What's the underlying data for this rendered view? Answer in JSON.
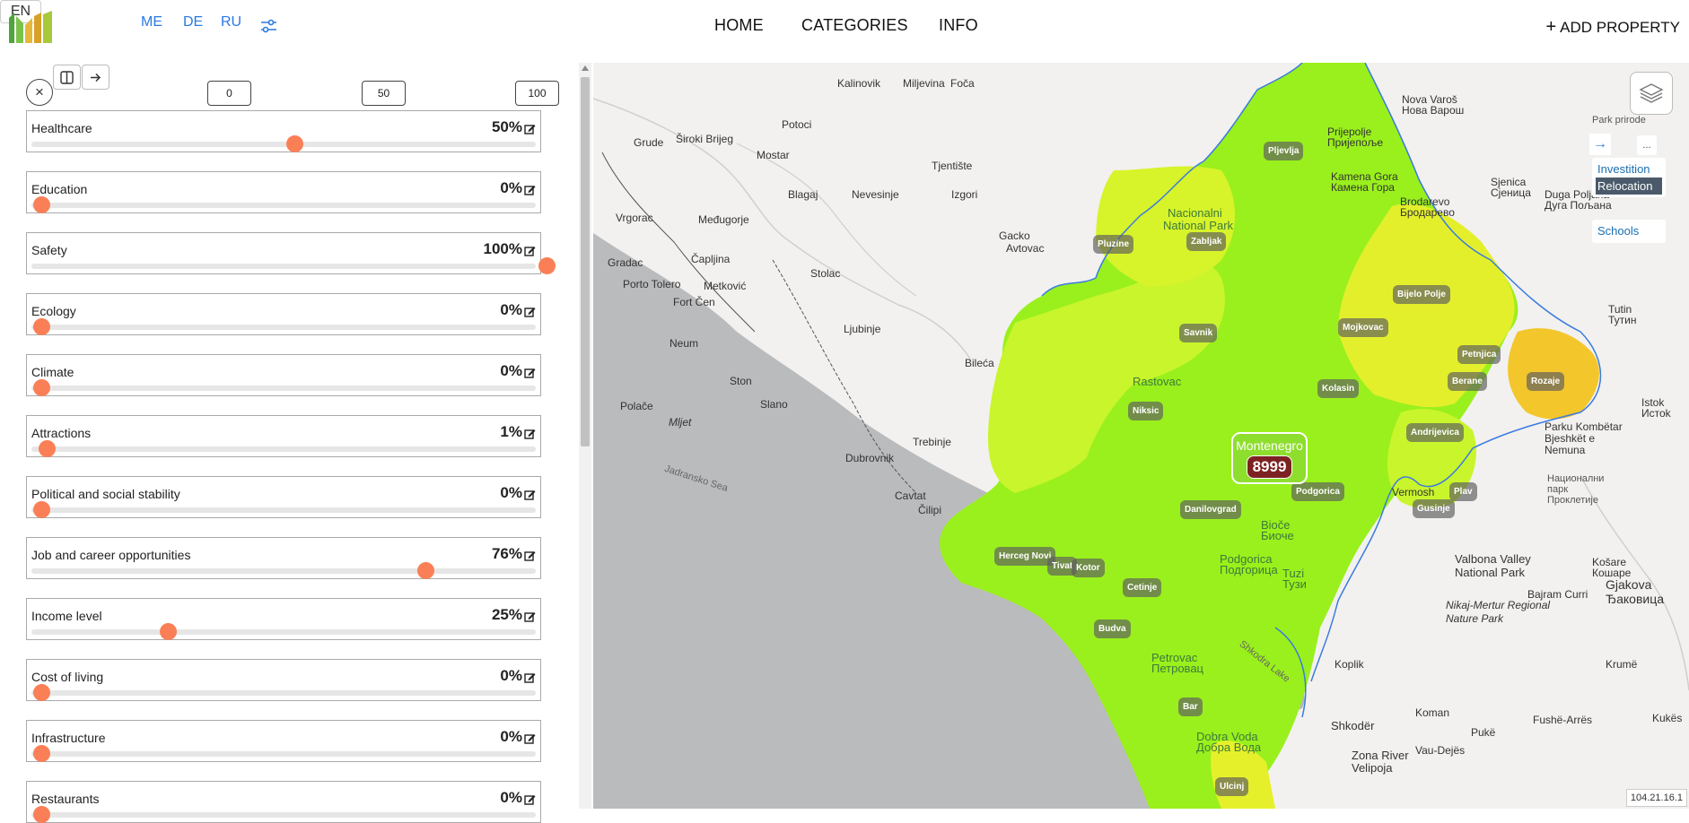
{
  "header": {
    "languages": [
      "EN",
      "ME",
      "DE",
      "RU"
    ],
    "active_language": "EN",
    "nav": [
      "HOME",
      "CATEGORIES",
      "INFO"
    ],
    "add_property": "ADD PROPERTY"
  },
  "sidebar": {
    "scale_marks": [
      "0",
      "50",
      "100"
    ],
    "criteria": [
      {
        "label": "Healthcare",
        "value": "50%",
        "level": 50
      },
      {
        "label": "Education",
        "value": "0%",
        "level": 0
      },
      {
        "label": "Safety",
        "value": "100%",
        "level": 100
      },
      {
        "label": "Ecology",
        "value": "0%",
        "level": 0
      },
      {
        "label": "Climate",
        "value": "0%",
        "level": 0
      },
      {
        "label": "Attractions",
        "value": "1%",
        "level": 1
      },
      {
        "label": "Political and social stability",
        "value": "0%",
        "level": 0
      },
      {
        "label": "Job and career opportunities",
        "value": "76%",
        "level": 76
      },
      {
        "label": "Income level",
        "value": "25%",
        "level": 25
      },
      {
        "label": "Cost of living",
        "value": "0%",
        "level": 0
      },
      {
        "label": "Infrastructure",
        "value": "0%",
        "level": 0
      },
      {
        "label": "Restaurants",
        "value": "0%",
        "level": 0
      }
    ]
  },
  "map": {
    "country": {
      "name": "Montenegro",
      "count": "8999"
    },
    "cities": [
      "Pljevlja",
      "Pluzine",
      "Zabljak",
      "Bijelo Polje",
      "Mojkovac",
      "Savnik",
      "Petnjica",
      "Rozaje",
      "Berane",
      "Kolasin",
      "Niksic",
      "Andrijevica",
      "Podgorica",
      "Plav",
      "Gusinje",
      "Danilovgrad",
      "Herceg Novi",
      "Tivat",
      "Kotor",
      "Cetinje",
      "Budva",
      "Bar",
      "Ulcinj"
    ],
    "places": [
      "Kalinovik",
      "Miljevina",
      "Foča",
      "Nova Varoš",
      "Нова Варош",
      "Park prirode",
      "Grude",
      "Široki Brijeg",
      "Potoci",
      "Mostar",
      "Prijepolje",
      "Пријепоље",
      "Tjentište",
      "Kamena Gora",
      "Камена Гора",
      "Brodarevo",
      "Бродарево",
      "Sjenica",
      "Сјеница",
      "Dugа Poljana",
      "Дуга Пољана",
      "Vrgorac",
      "Međugorje",
      "Blagaj",
      "Nevesinje",
      "Izgori",
      "Gacko",
      "Avtovac",
      "Nacionalni",
      "National Park",
      "Gradac",
      "Čapljina",
      "Stolac",
      "Porto Tolero",
      "Metković",
      "Fort Čen",
      "Ljubinje",
      "Bileća",
      "Neum",
      "Ston",
      "Polače",
      "Mljet",
      "Slano",
      "Trebinje",
      "Dubrovnik",
      "Cavtat",
      "Čilipi",
      "Rastovac",
      "Vermosh",
      "Tutin",
      "Тутин",
      "Istok",
      "Истоk",
      "Parku Kombëtar Bjeshkët e Nemuna",
      "Национални парк Проклетије",
      "Valbona Valley National Park",
      "Nikaj-Mertur Regional Nature Park",
      "Bajram Curri",
      "Gjakova",
      "Ђаковица",
      "Košare",
      "Кошаре",
      "Koplik",
      "Shkodër",
      "Koman",
      "Pukë",
      "Fushë-Arrës",
      "Kukës",
      "Krumë",
      "Vau-Dejës",
      "Zona River Velipoja",
      "Podgorica",
      "Подгорица",
      "Tuzi",
      "Тузи",
      "Bioče",
      "Биоче",
      "Petrovac",
      "Петровац",
      "Dobra Voda",
      "Добра Вода",
      "Jadransko Sea",
      "Shkodra Lake"
    ],
    "panel": {
      "investition": "Investition",
      "relocation": "Relocation",
      "schools": "Schools",
      "more": "..."
    },
    "ip": "104.21.16.1"
  },
  "colors": {
    "accent": "#fa7f56",
    "link": "#2a7ae2",
    "green": "#8ef21a",
    "lime": "#c8f52a",
    "yellow": "#e8ee2e",
    "orange": "#f5c72c",
    "sea": "#b9bbbd"
  }
}
